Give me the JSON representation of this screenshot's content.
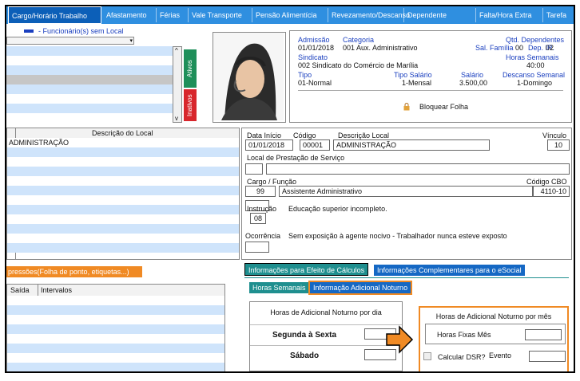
{
  "tabs": [
    "Cargo/Horário Trabalho",
    "Afastamento",
    "Férias",
    "Vale Transporte",
    "Pensão Alimentícia",
    "Revezamento/Descanso",
    "Dependente",
    "Falta/Hora Extra",
    "Tarefa"
  ],
  "left_top": {
    "legend": "- Funcionário(s) sem Local",
    "ativos": "Ativos",
    "inativos": "Inativos"
  },
  "info": {
    "admissao_label": "Admissão",
    "admissao_value": "01/01/2018",
    "categoria_label": "Categoria",
    "categoria_value": "001  Aux. Administrativo",
    "qtd_dep_label": "Qtd. Dependentes",
    "sal_familia_label": "Sal. Família",
    "sal_familia_value": "00",
    "dep_ir_label": "Dep. IR.",
    "dep_ir_value": "02",
    "sindicato_label": "Sindicato",
    "sindicato_value": "002  Sindicato do Comércio de Marília",
    "horas_sem_label": "Horas Semanais",
    "horas_sem_value": "40:00",
    "tipo_label": "Tipo",
    "tipo_value": "01-Normal",
    "tipo_sal_label": "Tipo Salário",
    "tipo_sal_value": "1-Mensal",
    "salario_label": "Salário",
    "salario_value": "3.500,00",
    "desc_sem_label": "Descanso Semanal",
    "desc_sem_value": "1-Domingo",
    "bloquear": "Bloquear Folha"
  },
  "local_list": {
    "header": "Descrição do Local",
    "items": [
      "ADMINISTRAÇÃO"
    ]
  },
  "form": {
    "data_inicio_label": "Data Início",
    "data_inicio": "01/01/2018",
    "codigo_label": "Código",
    "codigo": "00001",
    "desc_local_label": "Descrição Local",
    "desc_local": "ADMINISTRAÇÃO",
    "vinculo_label": "Vínculo",
    "vinculo": "10",
    "local_prest_label": "Local de Prestação de Serviço",
    "cargo_label": "Cargo  /  Função",
    "cargo_cod": "99",
    "cargo_desc": "Assistente Administrativo",
    "cbo_label": "Código CBO",
    "cbo": "4110-10",
    "instrucao_label": "Instrução",
    "instrucao_cod": "08",
    "instrucao_desc": "Educação superior incompleto.",
    "ocorrencia_label": "Ocorrência",
    "ocorrencia_desc": "Sem exposição à agente nocivo - Trabalhador nunca esteve exposto"
  },
  "bottom_left": {
    "impressoes": "pressões(Folha de ponto, etiquetas...)",
    "col_saida": "Saída",
    "col_intervalos": "Intervalos"
  },
  "bottom_right": {
    "tab1": "Informações para Efeito de Cálculos",
    "tab2": "Informações Complementares para o eSocial",
    "sub1": "Horas Semanais",
    "sub2": "Informação Adicional Noturno",
    "dia_title": "Horas de Adicional Noturno por dia",
    "seg_sex": "Segunda à Sexta",
    "sabado": "Sábado",
    "mes_title": "Horas de Adicional Noturno por mês",
    "horas_fixas": "Horas Fixas Mês",
    "calcular_dsr": "Calcular DSR?",
    "evento": "Evento"
  },
  "colors": {
    "tab_bg": "#2f8fe0",
    "highlight": "#f08a24",
    "stripe": "#cfe4fb",
    "green": "#1f8f5a",
    "red": "#d8262c"
  }
}
